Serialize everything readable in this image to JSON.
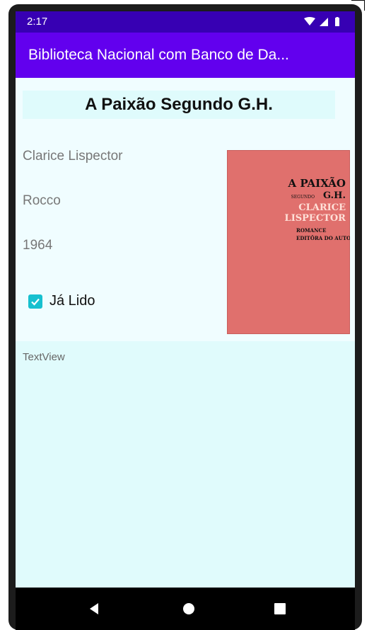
{
  "status_bar": {
    "time": "2:17"
  },
  "app_bar": {
    "title": "Biblioteca Nacional com Banco de Da..."
  },
  "book": {
    "title": "A Paixão Segundo G.H.",
    "author": "Clarice Lispector",
    "publisher": "Rocco",
    "year": "1964",
    "read_label": "Já Lido",
    "read_checked": true,
    "cover": {
      "line1": "A PAIXÃO",
      "line2_small": "SEGUNDO",
      "line2_big": "G.H.",
      "author_line1": "CLARICE",
      "author_line2": "LISPECTOR",
      "line_romance": "ROMANCE",
      "line_editora": "EDITÔRA DO AUTOR"
    }
  },
  "textview": {
    "text": "TextView"
  },
  "colors": {
    "status_bar": "#3700b3",
    "app_bar": "#6200ee",
    "background": "#e0fbfc",
    "accent": "#17c0cf",
    "cover": "#e0706d"
  },
  "nav": {
    "icons": [
      "back-icon",
      "home-icon",
      "recents-icon"
    ]
  }
}
